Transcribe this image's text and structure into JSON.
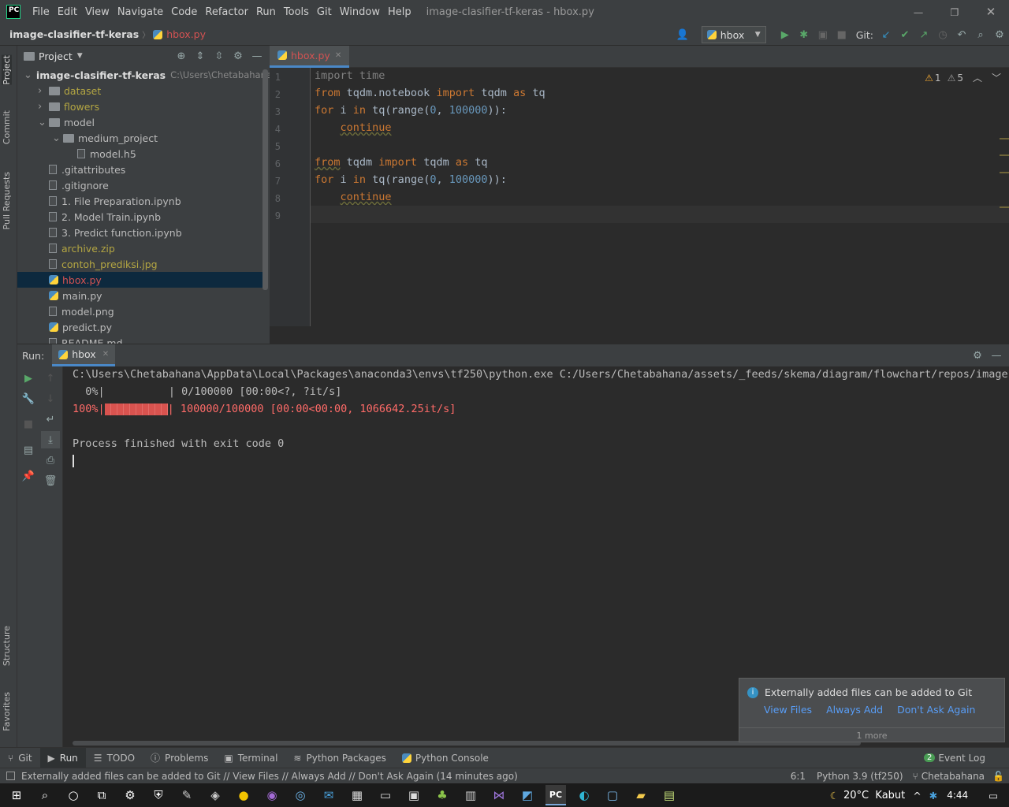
{
  "titlebar": {
    "app_logo": "PC",
    "menus": [
      "File",
      "Edit",
      "View",
      "Navigate",
      "Code",
      "Refactor",
      "Run",
      "Tools",
      "Git",
      "Window",
      "Help"
    ],
    "window_title": "image-clasifier-tf-keras - hbox.py",
    "minimize_glyph": "—",
    "restore_glyph": "❐",
    "close_glyph": "✕"
  },
  "navbar": {
    "project": "image-clasifier-tf-keras",
    "separator": "〉",
    "file": "hbox.py",
    "run_config": "hbox",
    "git_label": "Git:"
  },
  "left_strip": {
    "project": "Project",
    "commit": "Commit",
    "pull_requests": "Pull Requests",
    "structure": "Structure",
    "favorites": "Favorites"
  },
  "project_panel": {
    "title": "Project",
    "tree": [
      {
        "label": "image-clasifier-tf-keras",
        "path": "C:\\Users\\Chetabahana\\ass",
        "type": "root"
      },
      {
        "label": "dataset",
        "type": "folder",
        "color": "#b4a642"
      },
      {
        "label": "flowers",
        "type": "folder",
        "color": "#b4a642"
      },
      {
        "label": "model",
        "type": "folder-open",
        "color": "#bbbbbb"
      },
      {
        "label": "medium_project",
        "type": "folder-open",
        "color": "#bbbbbb"
      },
      {
        "label": "model.h5",
        "type": "file",
        "color": "#bbbbbb"
      },
      {
        "label": ".gitattributes",
        "type": "file",
        "color": "#bbbbbb"
      },
      {
        "label": ".gitignore",
        "type": "file",
        "color": "#bbbbbb"
      },
      {
        "label": "1. File Preparation.ipynb",
        "type": "file",
        "color": "#bbbbbb"
      },
      {
        "label": "2. Model Train.ipynb",
        "type": "file",
        "color": "#bbbbbb"
      },
      {
        "label": "3. Predict function.ipynb",
        "type": "file",
        "color": "#bbbbbb"
      },
      {
        "label": "archive.zip",
        "type": "file",
        "color": "#b4a642"
      },
      {
        "label": "contoh_prediksi.jpg",
        "type": "file",
        "color": "#b4a642"
      },
      {
        "label": "hbox.py",
        "type": "py",
        "color": "#d25252"
      },
      {
        "label": "main.py",
        "type": "py",
        "color": "#bbbbbb"
      },
      {
        "label": "model.png",
        "type": "file",
        "color": "#bbbbbb"
      },
      {
        "label": "predict.py",
        "type": "py",
        "color": "#bbbbbb"
      },
      {
        "label": "README.md",
        "type": "file",
        "color": "#bbbbbb"
      }
    ]
  },
  "editor": {
    "tab": "hbox.py",
    "tab_close": "✕",
    "warnings": "1",
    "weak_warnings": "5",
    "lines": [
      {
        "n": "1",
        "parts": [
          {
            "t": "import time",
            "c": "gray"
          }
        ]
      },
      {
        "n": "2",
        "parts": [
          {
            "t": "from",
            "c": "kw"
          },
          {
            "t": " tqdm.notebook ",
            "c": ""
          },
          {
            "t": "import",
            "c": "kw"
          },
          {
            "t": " tqdm ",
            "c": ""
          },
          {
            "t": "as",
            "c": "kw"
          },
          {
            "t": " tq",
            "c": ""
          }
        ]
      },
      {
        "n": "3",
        "parts": [
          {
            "t": "for",
            "c": "kw"
          },
          {
            "t": " i ",
            "c": ""
          },
          {
            "t": "in",
            "c": "kw"
          },
          {
            "t": " tq(range(",
            "c": ""
          },
          {
            "t": "0",
            "c": "num"
          },
          {
            "t": ", ",
            "c": ""
          },
          {
            "t": "100000",
            "c": "num"
          },
          {
            "t": ")):",
            "c": ""
          }
        ]
      },
      {
        "n": "4",
        "parts": [
          {
            "t": "    ",
            "c": ""
          },
          {
            "t": "continue",
            "c": "kw und"
          }
        ]
      },
      {
        "n": "5",
        "parts": []
      },
      {
        "n": "6",
        "parts": [
          {
            "t": "from",
            "c": "kw und"
          },
          {
            "t": " tqdm ",
            "c": ""
          },
          {
            "t": "import",
            "c": "kw"
          },
          {
            "t": " tqdm ",
            "c": ""
          },
          {
            "t": "as",
            "c": "kw"
          },
          {
            "t": " tq",
            "c": ""
          }
        ]
      },
      {
        "n": "7",
        "parts": [
          {
            "t": "for",
            "c": "kw"
          },
          {
            "t": " i ",
            "c": ""
          },
          {
            "t": "in",
            "c": "kw"
          },
          {
            "t": " tq(range(",
            "c": ""
          },
          {
            "t": "0",
            "c": "num"
          },
          {
            "t": ", ",
            "c": ""
          },
          {
            "t": "100000",
            "c": "num"
          },
          {
            "t": ")):",
            "c": ""
          }
        ]
      },
      {
        "n": "8",
        "parts": [
          {
            "t": "    ",
            "c": ""
          },
          {
            "t": "continue",
            "c": "kw und"
          }
        ]
      },
      {
        "n": "9",
        "parts": []
      }
    ]
  },
  "run_panel": {
    "label": "Run:",
    "tab": "hbox",
    "tab_close": "✕",
    "output": [
      {
        "text": "C:\\Users\\Chetabahana\\AppData\\Local\\Packages\\anaconda3\\envs\\tf250\\python.exe C:/Users/Chetabahana/assets/_feeds/skema/diagram/flowchart/repos/image-cl",
        "color": "#bbbbbb"
      },
      {
        "text": "  0%|          | 0/100000 [00:00<?, ?it/s]",
        "color": "#bbbbbb"
      },
      {
        "text": "100%|",
        "color": "#ff6b68",
        "bar": true,
        "after": "| 100000/100000 [00:00<00:00, 1066642.25it/s]"
      },
      {
        "text": "",
        "color": "#bbbbbb"
      },
      {
        "text": "Process finished with exit code 0",
        "color": "#bbbbbb"
      }
    ]
  },
  "notification": {
    "message": "Externally added files can be added to Git",
    "actions": [
      "View Files",
      "Always Add",
      "Don't Ask Again"
    ],
    "more": "1 more"
  },
  "bottom_tabs": [
    "Git",
    "Run",
    "TODO",
    "Problems",
    "Terminal",
    "Python Packages",
    "Python Console"
  ],
  "event_log": {
    "count": "2",
    "label": "Event Log"
  },
  "status": {
    "message": "Externally added files can be added to Git // View Files // Always Add // Don't Ask Again (14 minutes ago)",
    "position": "6:1",
    "interpreter": "Python 3.9 (tf250)",
    "branch": "Chetabahana"
  },
  "taskbar": {
    "weather": "20°C  Kabut",
    "time": "4:44"
  },
  "colors": {
    "accent": "#589df6",
    "error": "#d25252",
    "selection": "#0d293e"
  }
}
